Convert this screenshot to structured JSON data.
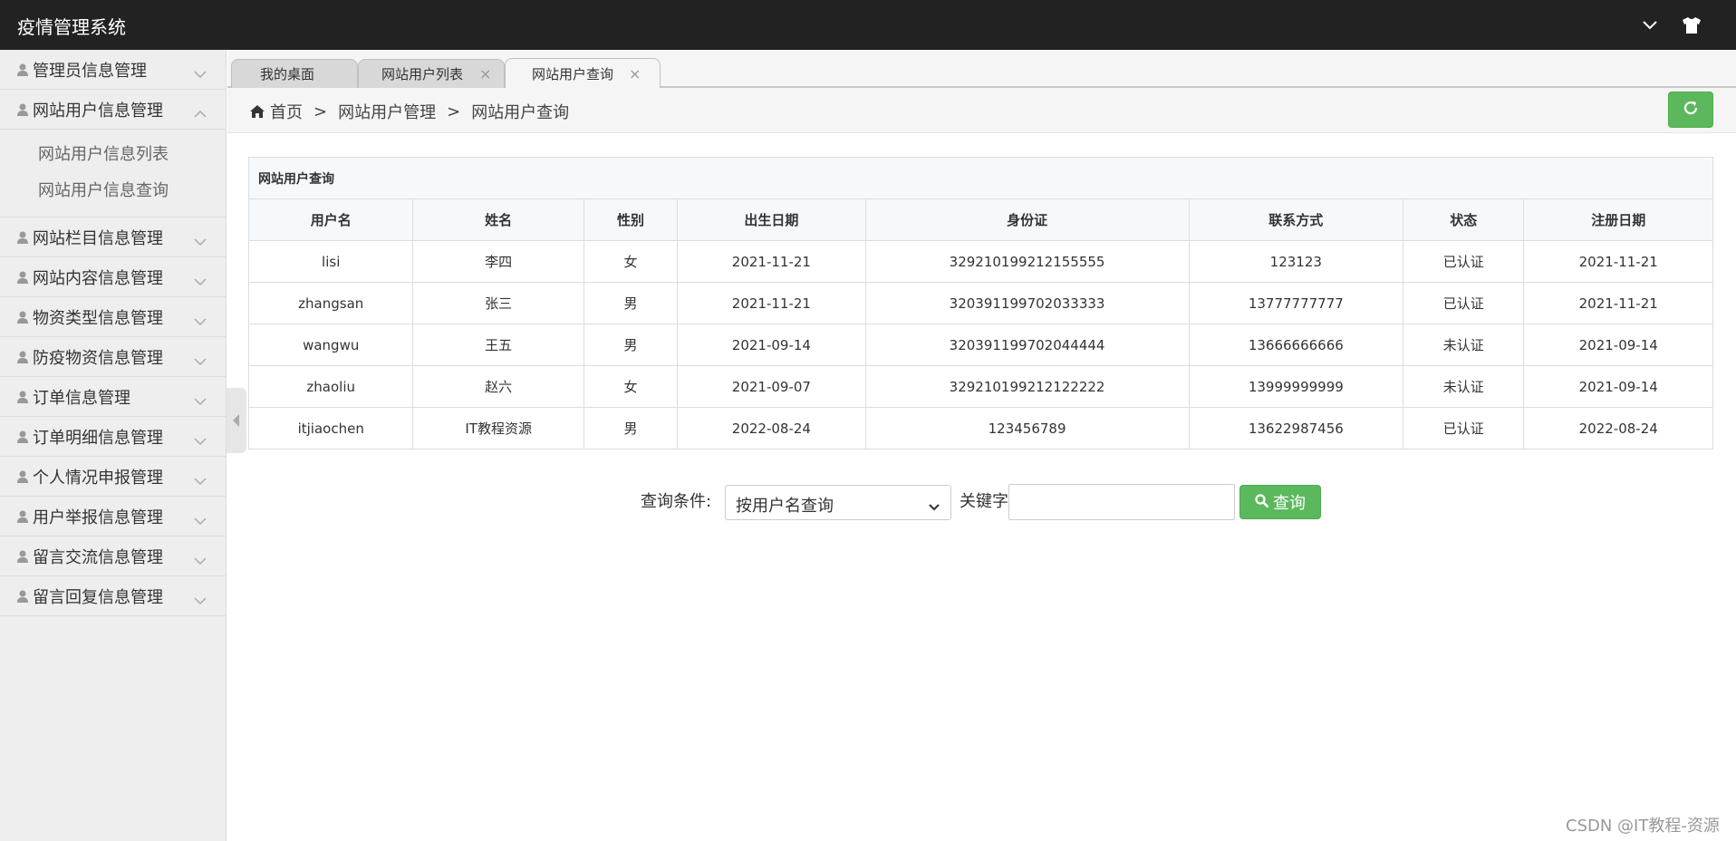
{
  "app": {
    "title": "疫情管理系统"
  },
  "sidebar": {
    "items": [
      {
        "label": "管理员信息管理",
        "expanded": false
      },
      {
        "label": "网站用户信息管理",
        "expanded": true
      },
      {
        "label": "网站栏目信息管理",
        "expanded": false
      },
      {
        "label": "网站内容信息管理",
        "expanded": false
      },
      {
        "label": "物资类型信息管理",
        "expanded": false
      },
      {
        "label": "防疫物资信息管理",
        "expanded": false
      },
      {
        "label": "订单信息管理",
        "expanded": false
      },
      {
        "label": "订单明细信息管理",
        "expanded": false
      },
      {
        "label": "个人情况申报管理",
        "expanded": false
      },
      {
        "label": "用户举报信息管理",
        "expanded": false
      },
      {
        "label": "留言交流信息管理",
        "expanded": false
      },
      {
        "label": "留言回复信息管理",
        "expanded": false
      }
    ],
    "submenu": [
      "网站用户信息列表",
      "网站用户信息查询"
    ]
  },
  "tabs": [
    {
      "label": "我的桌面",
      "closable": false,
      "active": false
    },
    {
      "label": "网站用户列表",
      "closable": true,
      "active": false
    },
    {
      "label": "网站用户查询",
      "closable": true,
      "active": true
    }
  ],
  "breadcrumb": {
    "home": "首页",
    "sep": ">",
    "level1": "网站用户管理",
    "level2": "网站用户查询"
  },
  "table": {
    "title": "网站用户查询",
    "columns": [
      "用户名",
      "姓名",
      "性别",
      "出生日期",
      "身份证",
      "联系方式",
      "状态",
      "注册日期"
    ],
    "rows": [
      [
        "lisi",
        "李四",
        "女",
        "2021-11-21",
        "329210199212155555",
        "123123",
        "已认证",
        "2021-11-21"
      ],
      [
        "zhangsan",
        "张三",
        "男",
        "2021-11-21",
        "320391199702033333",
        "13777777777",
        "已认证",
        "2021-11-21"
      ],
      [
        "wangwu",
        "王五",
        "男",
        "2021-09-14",
        "320391199702044444",
        "13666666666",
        "未认证",
        "2021-09-14"
      ],
      [
        "zhaoliu",
        "赵六",
        "女",
        "2021-09-07",
        "329210199212122222",
        "13999999999",
        "未认证",
        "2021-09-14"
      ],
      [
        "itjiaochen",
        "IT教程资源",
        "男",
        "2022-08-24",
        "123456789",
        "13622987456",
        "已认证",
        "2022-08-24"
      ]
    ]
  },
  "search": {
    "condition_label": "查询条件:",
    "condition_value": "按用户名查询",
    "keyword_label": "关键字",
    "keyword_value": "",
    "button_label": "查询"
  },
  "watermark": "CSDN @IT教程-资源",
  "colors": {
    "topbar": "#222222",
    "sidebar": "#eeeeee",
    "accent_green": "#5cb85c"
  }
}
